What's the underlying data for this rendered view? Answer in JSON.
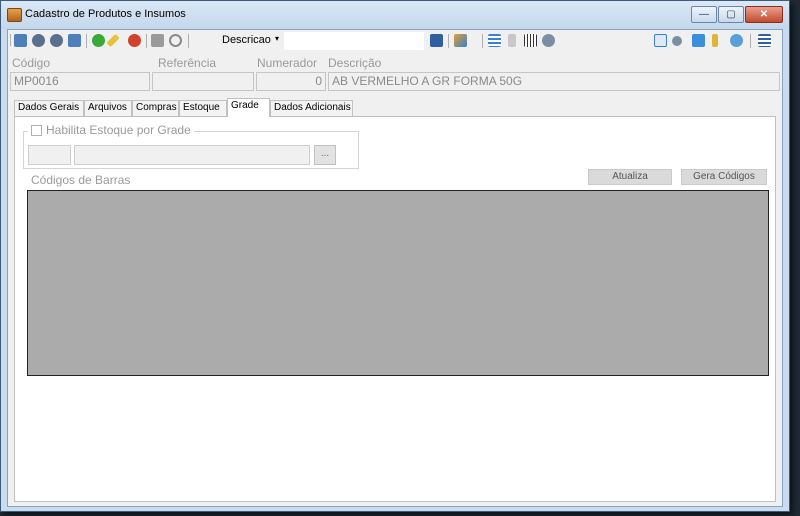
{
  "window": {
    "title": "Cadastro de Produtos e Insumos",
    "minimize": "—",
    "maximize": "▢",
    "close": "✕"
  },
  "toolbar": {
    "sort_field": "Descricao",
    "sort_arrow": "▾",
    "icons_left": [
      "first-record-icon",
      "previous-record-icon",
      "next-record-icon",
      "last-record-icon",
      "add-icon",
      "edit-icon",
      "delete-icon",
      "save-icon",
      "undo-icon"
    ],
    "icons_right": [
      "export-icon",
      "chart-icon",
      "list-icon",
      "report-icon",
      "barcode-icon",
      "tools-icon",
      "window-icon",
      "settings-icon",
      "refresh-icon",
      "filter-icon",
      "user-icon",
      "menu-icon"
    ]
  },
  "header": {
    "codigo_label": "Código",
    "codigo_value": "MP0016",
    "referencia_label": "Referência",
    "referencia_value": "",
    "numerador_label": "Numerador",
    "numerador_value": "0",
    "descricao_label": "Descrição",
    "descricao_value": "AB VERMELHO A GR FORMA 50G"
  },
  "tabs": [
    "Dados Gerais",
    "Arquivos",
    "Compras",
    "Estoque",
    "Grade",
    "Dados Adicionais"
  ],
  "active_tab": "Grade",
  "grade": {
    "habilita_label": "Habilita Estoque por Grade",
    "habilita_checked": false,
    "ellipsis": "...",
    "codigos_label": "Códigos de Barras",
    "atualiza_label": "Atualiza",
    "gera_codigos_label": "Gera Códigos"
  },
  "colors": {
    "title_bar": "#c9dcef",
    "grid_bg": "#ababab",
    "close_button": "#c24a2f"
  }
}
